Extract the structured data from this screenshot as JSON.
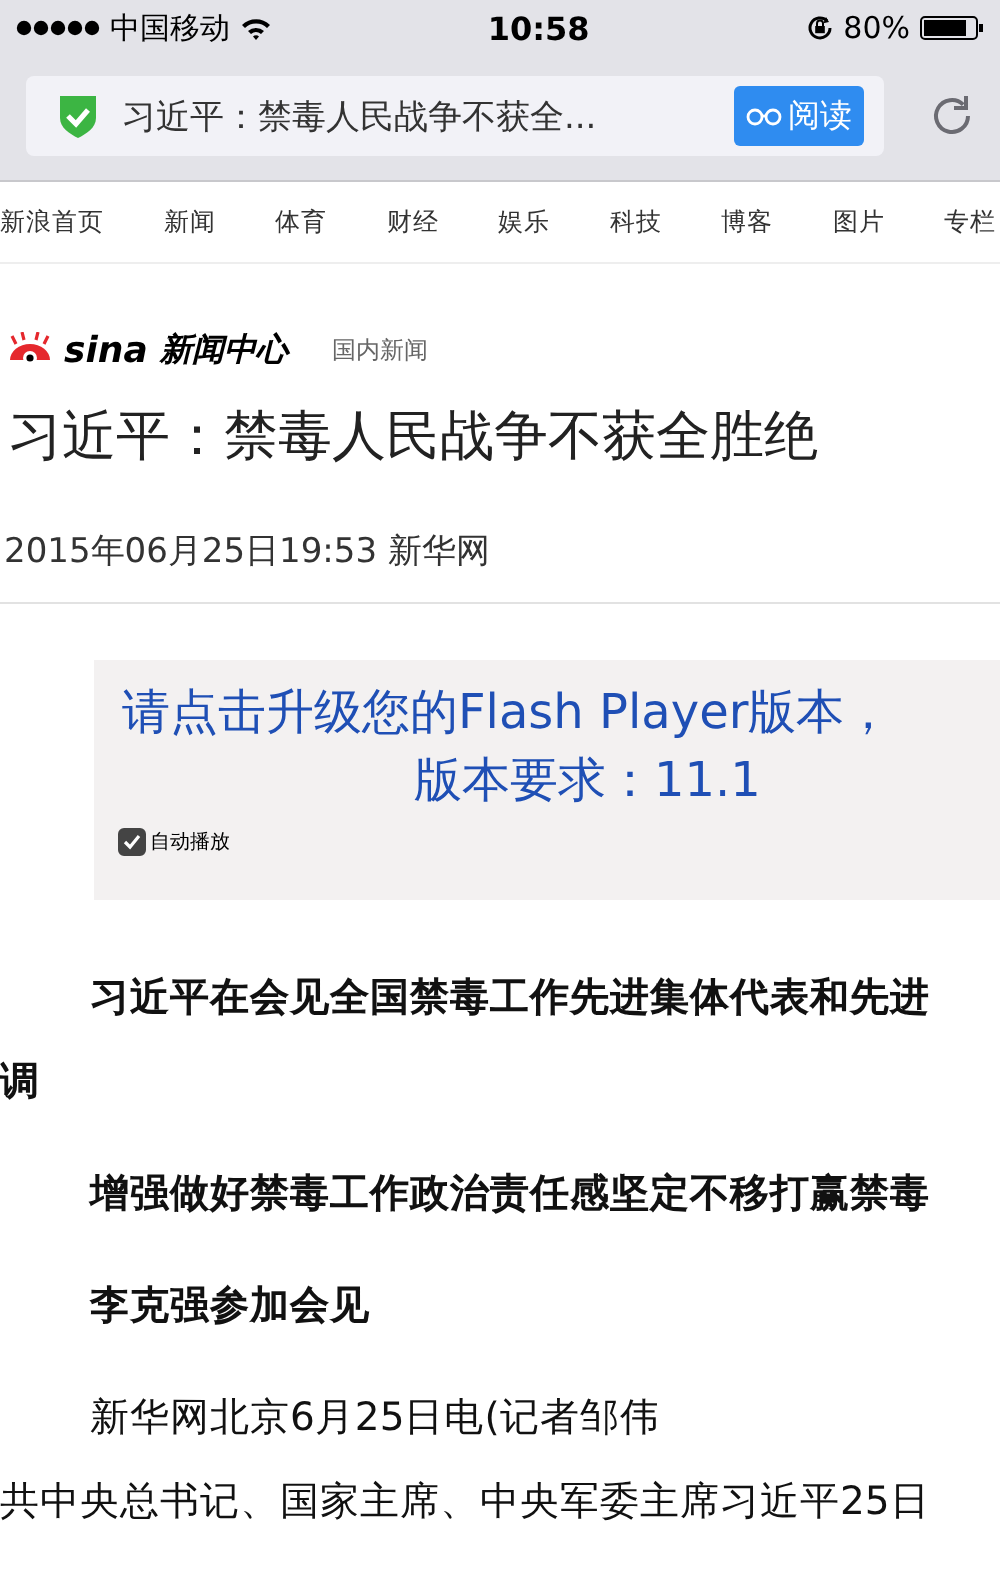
{
  "status_bar": {
    "carrier": "中国移动",
    "time": "10:58",
    "battery": "80%"
  },
  "address_bar": {
    "title": "习近平：禁毒人民战争不获全...",
    "reader_button": "阅读"
  },
  "nav": [
    {
      "label": "新浪首页"
    },
    {
      "label": "新闻"
    },
    {
      "label": "体育"
    },
    {
      "label": "财经"
    },
    {
      "label": "娱乐"
    },
    {
      "label": "科技"
    },
    {
      "label": "博客"
    },
    {
      "label": "图片"
    },
    {
      "label": "专栏"
    }
  ],
  "header": {
    "logo_text": "sina",
    "section": "新闻中心",
    "category": "国内新闻"
  },
  "article": {
    "title": "习近平：禁毒人民战争不获全胜绝",
    "meta": "2015年06月25日19:53 新华网"
  },
  "flash": {
    "message": "请点击升级您的Flash Player版本，",
    "version": "版本要求：11.1",
    "autoplay": {
      "label": "自动播放",
      "checked": true
    }
  },
  "paragraphs": [
    {
      "kind": "bold",
      "lines": [
        "习近平在会见全国禁毒工作先进集体代表和先进",
        "调"
      ]
    },
    {
      "kind": "bold",
      "lines": [
        "增强做好禁毒工作政治责任感坚定不移打赢禁毒"
      ]
    },
    {
      "kind": "bold",
      "lines": [
        "李克强参加会见"
      ]
    },
    {
      "kind": "plain",
      "lines": [
        "新华网北京6月25日电(记者邹伟",
        "共中央总书记、国家主席、中央军委主席习近平25日"
      ]
    }
  ]
}
